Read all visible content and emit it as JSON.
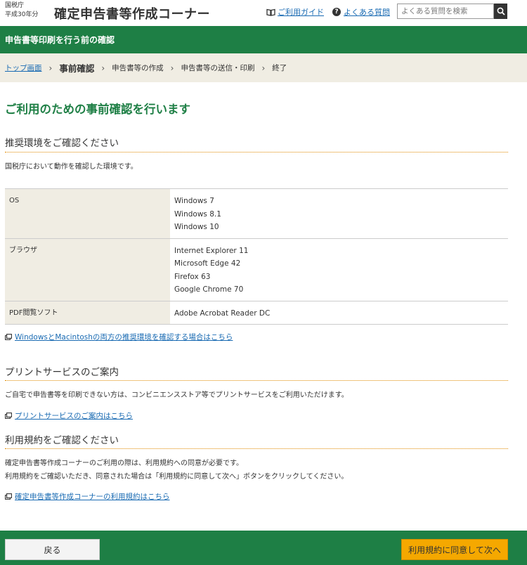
{
  "header": {
    "org_line1": "国税庁",
    "org_line2": "平成30年分",
    "title": "確定申告書等作成コーナー",
    "guide_link": "ご利用ガイド",
    "faq_link": "よくある質問",
    "search_placeholder": "よくある質問を検索"
  },
  "page_banner": "申告書等印刷を行う前の確認",
  "breadcrumb": {
    "top": "トップ画面",
    "current": "事前確認",
    "step3": "申告書等の作成",
    "step4": "申告書等の送信・印刷",
    "step5": "終了"
  },
  "main_title": "ご利用のための事前確認を行います",
  "env_section": {
    "heading": "推奨環境をご確認ください",
    "desc": "国税庁において動作を確認した環境です。",
    "rows": [
      {
        "key": "OS",
        "values": [
          "Windows 7",
          "Windows 8.1",
          "Windows 10"
        ]
      },
      {
        "key": "ブラウザ",
        "values": [
          "Internet Explorer 11",
          "Microsoft Edge 42",
          "Firefox 63",
          "Google Chrome 70"
        ]
      },
      {
        "key": "PDF閲覧ソフト",
        "values": [
          "Adobe Acrobat Reader DC"
        ]
      }
    ],
    "link": "WindowsとMacintoshの両方の推奨環境を確認する場合はこちら"
  },
  "print_section": {
    "heading": "プリントサービスのご案内",
    "desc": "ご自宅で申告書等を印刷できない方は、コンビニエンスストア等でプリントサービスをご利用いただけます。",
    "link": "プリントサービスのご案内はこちら"
  },
  "terms_section": {
    "heading": "利用規約をご確認ください",
    "desc1": "確定申告書等作成コーナーのご利用の際は、利用規約への同意が必要です。",
    "desc2": "利用規約をご確認いただき、同意された場合は「利用規約に同意して次へ」ボタンをクリックしてください。",
    "link": "確定申告書等作成コーナーの利用規約はこちら"
  },
  "footer": {
    "back_label": "戻る",
    "next_label": "利用規約に同意して次へ"
  },
  "colors": {
    "brand_green": "#1e7f45",
    "accent_orange": "#f5a800",
    "link_blue": "#1a6bb3"
  }
}
